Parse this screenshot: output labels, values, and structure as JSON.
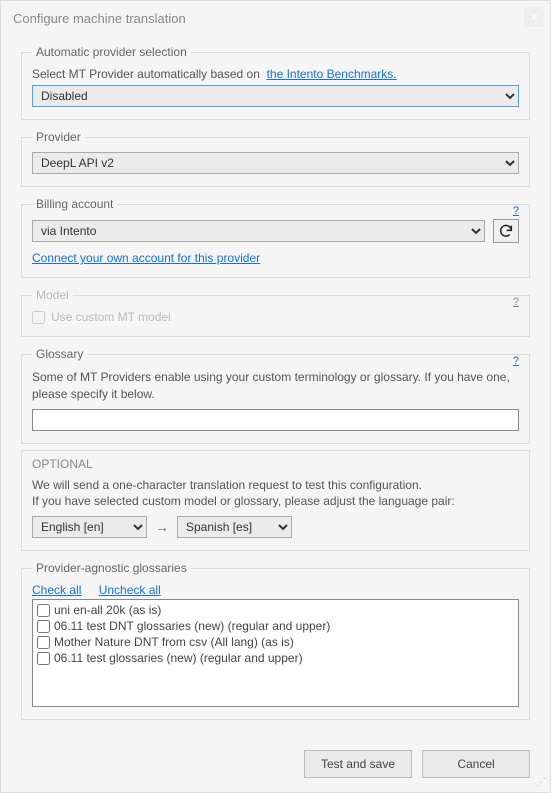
{
  "title": "Configure machine translation",
  "sections": {
    "auto": {
      "legend": "Automatic provider selection",
      "label": "Select MT Provider automatically based on",
      "link": "the Intento Benchmarks.",
      "selected": "Disabled"
    },
    "provider": {
      "legend": "Provider",
      "selected": "DeepL API v2"
    },
    "billing": {
      "legend": "Billing account",
      "help": "?",
      "selected": "via Intento",
      "connect_link": "Connect your own account for this provider"
    },
    "model": {
      "legend": "Model",
      "help": "?",
      "checkbox_label": "Use custom MT model"
    },
    "glossary": {
      "legend": "Glossary",
      "help": "?",
      "text": "Some of MT Providers enable using your custom terminology or glossary. If you have one, please specify it below.",
      "value": ""
    },
    "optional": {
      "title": "OPTIONAL",
      "line1": "We will send a one-character translation request to test this configuration.",
      "line2": "If you have selected custom model or glossary, please adjust the language pair:",
      "src": "English [en]",
      "tgt": "Spanish [es]"
    },
    "agnostic": {
      "legend": "Provider-agnostic glossaries",
      "check_all": "Check all",
      "uncheck_all": "Uncheck all",
      "items": [
        "uni en-all 20k (as is)",
        "06.11 test DNT glossaries (new) (regular and upper)",
        "Mother Nature DNT from csv (All lang) (as is)",
        "06.11 test glossaries (new) (regular and upper)"
      ]
    }
  },
  "buttons": {
    "test_save": "Test and save",
    "cancel": "Cancel"
  }
}
